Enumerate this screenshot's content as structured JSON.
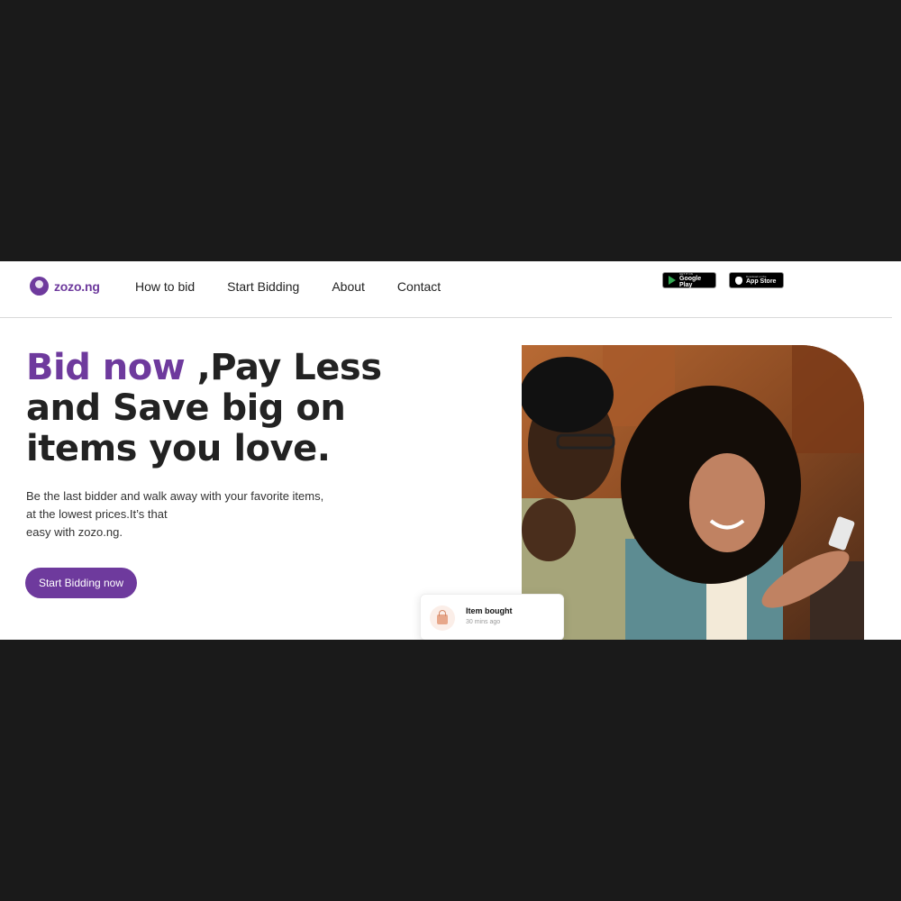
{
  "brand": {
    "name": "zozo.ng",
    "color": "#6e3a9d"
  },
  "nav": {
    "links": [
      "How to bid",
      "Start Bidding",
      "About",
      "Contact"
    ]
  },
  "stores": {
    "google_play": {
      "small": "GET IT ON",
      "big": "Google Play"
    },
    "app_store": {
      "small": "Download on the",
      "big": "App Store"
    }
  },
  "hero": {
    "headline_accent": "Bid now",
    "headline_rest": " ,Pay Less and Save big on items you love.",
    "subtext_line1": "Be the last bidder and walk away with your favorite items,",
    "subtext_line2": "at the lowest prices.It’s that",
    "subtext_line3": "easy with zozo.ng.",
    "cta_label": "Start Bidding now"
  },
  "notification": {
    "title": "Item bought",
    "time": "30 mins ago",
    "icon": "shopping-bag-icon"
  },
  "colors": {
    "accent": "#6e3a9d",
    "page_background": "#1a1a1a",
    "text": "#222222"
  }
}
